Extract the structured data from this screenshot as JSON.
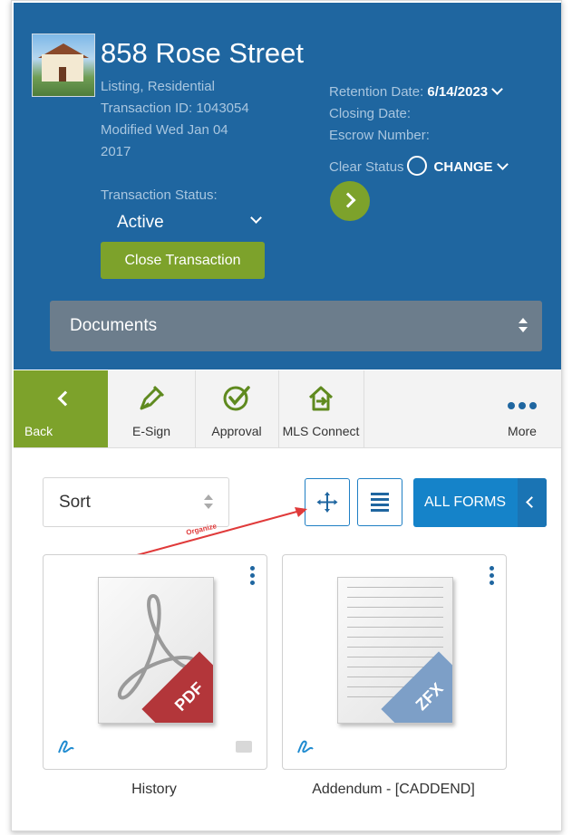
{
  "header": {
    "property_title": "858 Rose Street",
    "listing_type": "Listing, Residential",
    "transaction_id": "Transaction ID: 1043054",
    "modified_line1": "Modified Wed Jan 04",
    "modified_line2": "2017",
    "retention_label": "Retention Date:",
    "retention_value": "6/14/2023",
    "closing_label": "Closing Date:",
    "escrow_label": "Escrow Number:",
    "clear_status_label": "Clear Status",
    "change_label": "CHANGE",
    "transaction_status_label": "Transaction Status:",
    "transaction_status_value": "Active",
    "close_button_label": "Close Transaction",
    "section_select_value": "Documents"
  },
  "toolbar": {
    "items": [
      {
        "label": "Back",
        "icon": "chevron-left-icon"
      },
      {
        "label": "E-Sign",
        "icon": "pen-icon"
      },
      {
        "label": "Approval",
        "icon": "check-circle-icon"
      },
      {
        "label": "MLS Connect",
        "icon": "house-import-icon"
      },
      {
        "label": "More",
        "icon": "ellipsis-icon"
      }
    ]
  },
  "controls": {
    "sort_value": "Sort",
    "organize_annotation": "Organize",
    "all_forms_label": "ALL FORMS"
  },
  "documents": [
    {
      "name": "History",
      "badge": "PDF",
      "badge_color": "#b3363a"
    },
    {
      "name": "Addendum - [CADDEND]",
      "badge": "ZFX",
      "badge_color": "#7d9fc7"
    }
  ],
  "colors": {
    "header_bg": "#1f66a0",
    "accent_green": "#7da22b",
    "primary_blue": "#1583c9",
    "annotation_red": "#e03a3a"
  }
}
